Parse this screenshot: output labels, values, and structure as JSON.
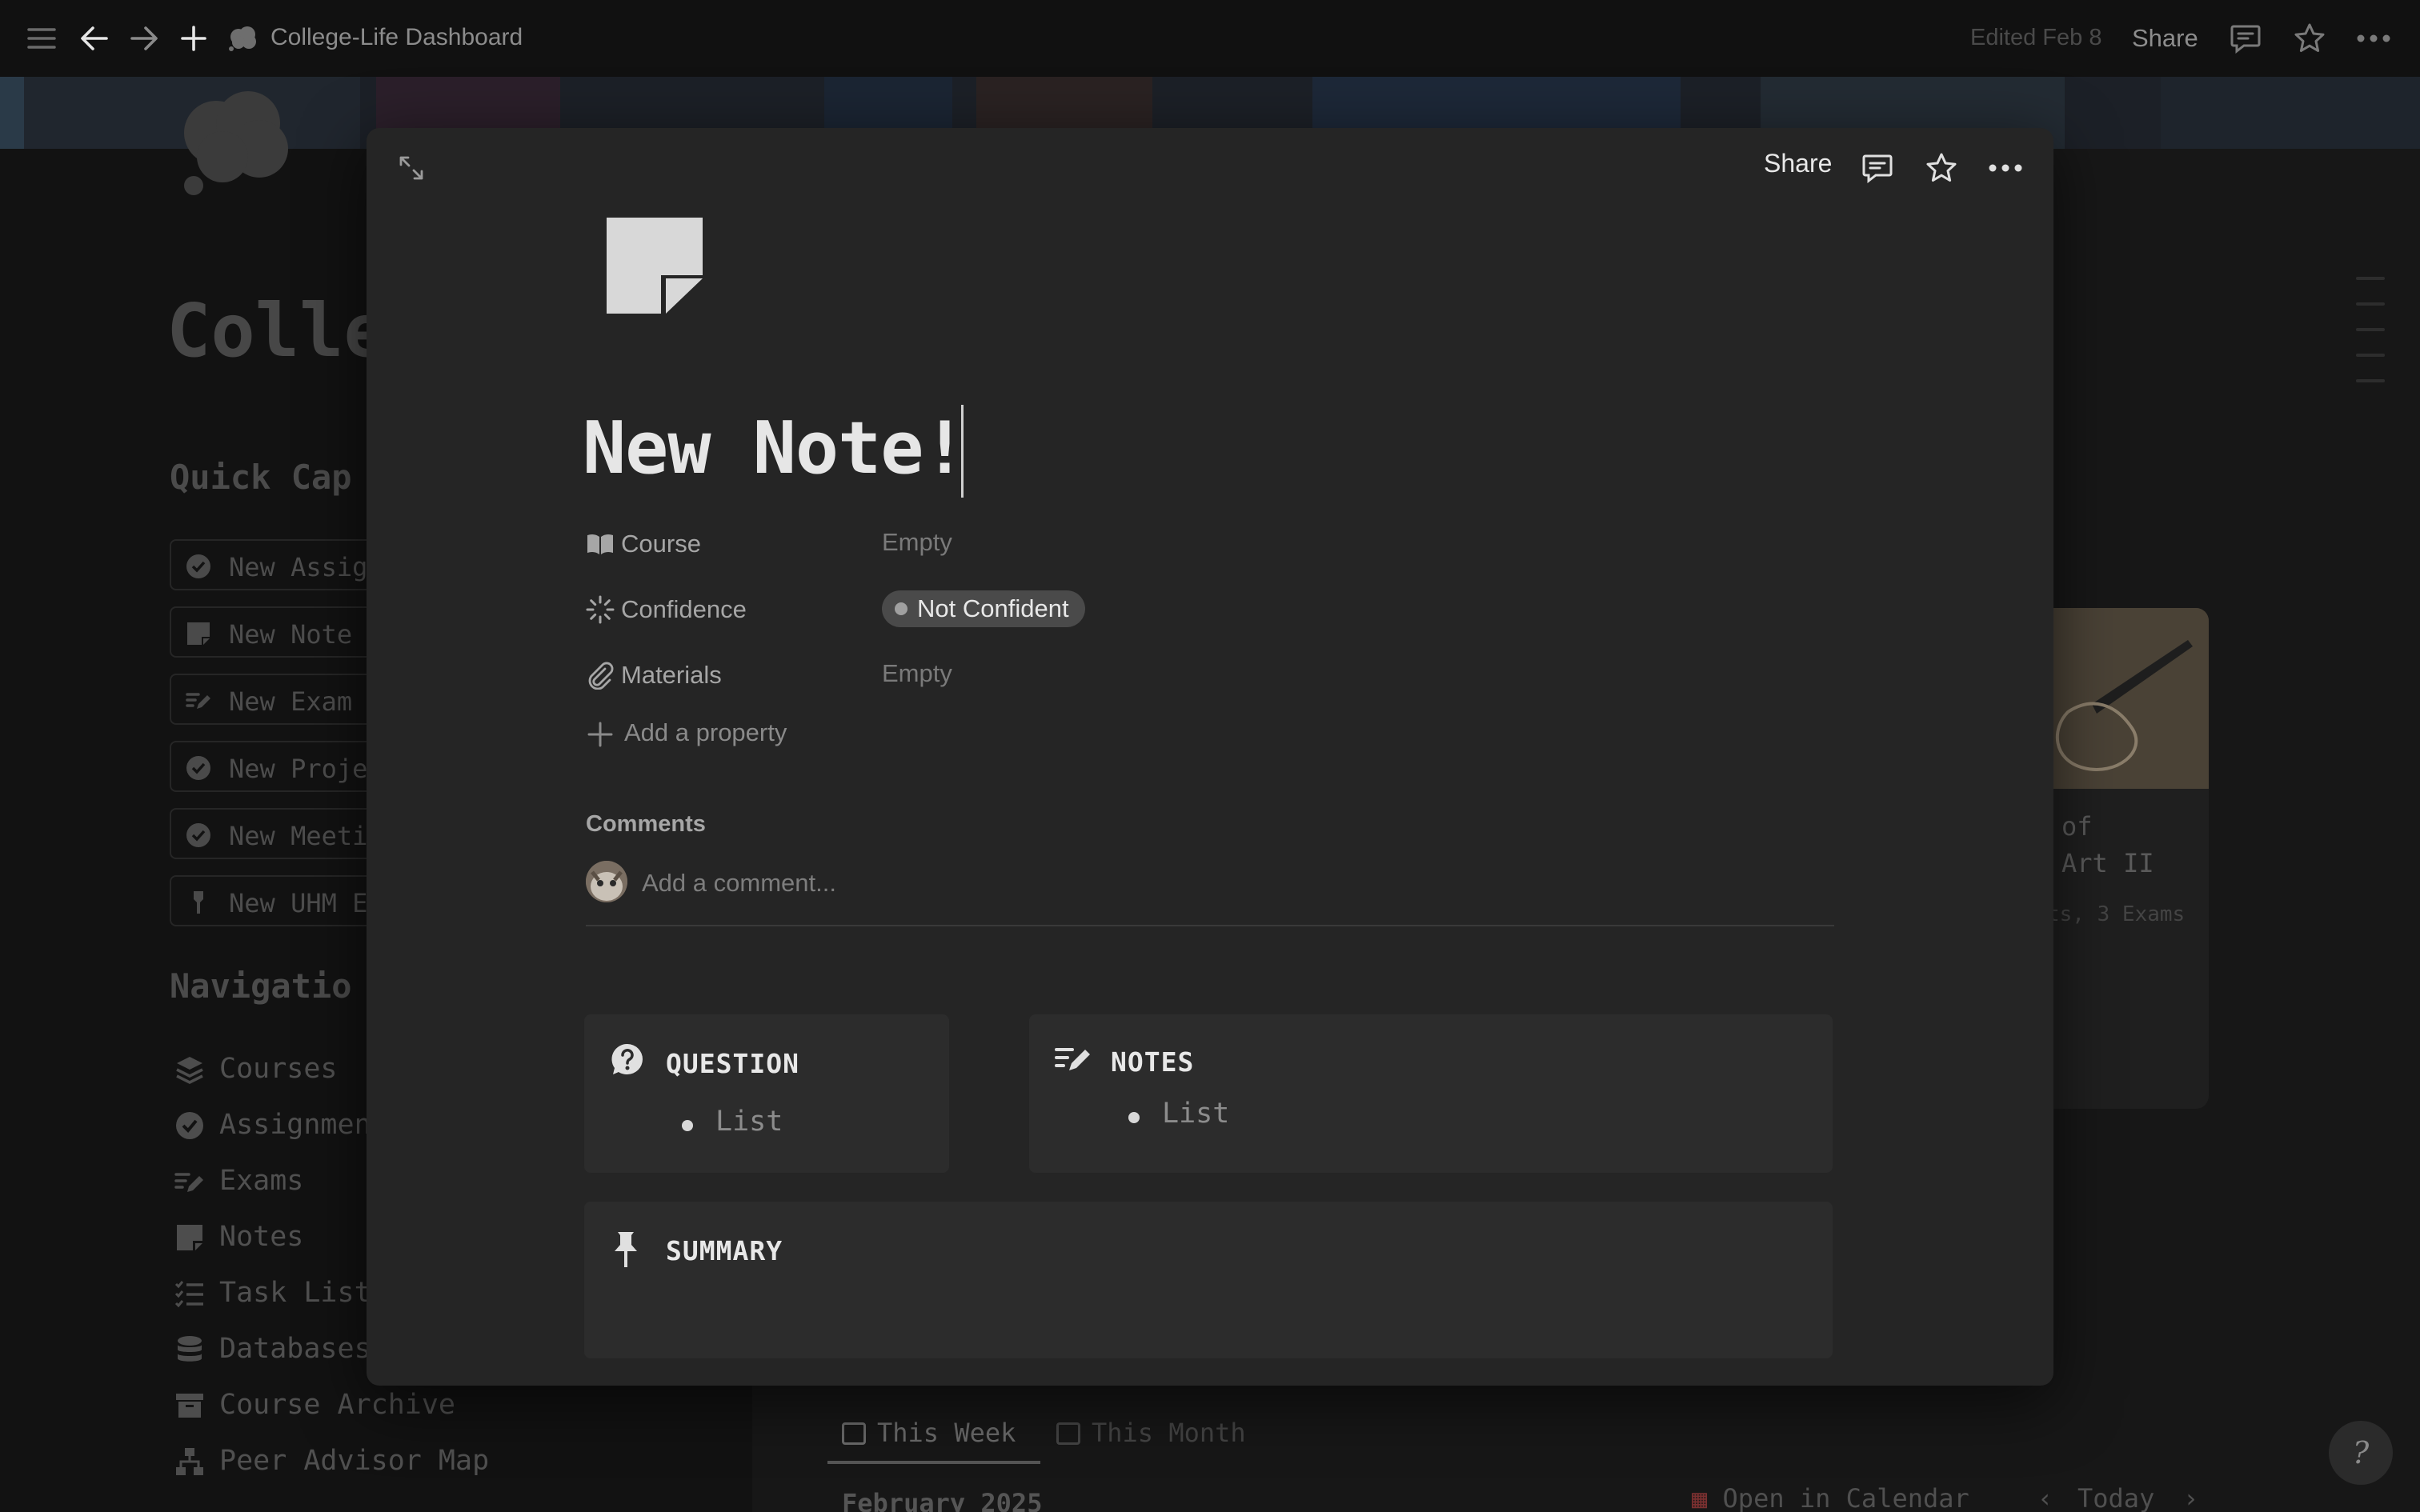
{
  "topbar": {
    "breadcrumb_title": "College-Life Dashboard",
    "edited": "Edited Feb 8",
    "share_label": "Share",
    "icons": [
      "menu-icon",
      "back-arrow-icon",
      "forward-arrow-icon",
      "plus-icon",
      "cloud-icon",
      "comment-icon",
      "star-icon",
      "more-icon"
    ]
  },
  "dashboard": {
    "title": "Colle",
    "quick_capture": {
      "heading": "Quick Cap",
      "items": [
        {
          "label": "New Assig",
          "icon": "check-circle-icon"
        },
        {
          "label": "New Note",
          "icon": "note-icon"
        },
        {
          "label": "New Exam",
          "icon": "pencil-lines-icon"
        },
        {
          "label": "New Proje",
          "icon": "check-circle-icon"
        },
        {
          "label": "New Meeti",
          "icon": "check-circle-icon"
        },
        {
          "label": "New UHM E",
          "icon": "torch-icon"
        }
      ]
    },
    "navigation": {
      "heading": "Navigatio",
      "items": [
        {
          "label": "Courses",
          "icon": "layers-icon"
        },
        {
          "label": "Assignmen",
          "icon": "check-circle-icon"
        },
        {
          "label": "Exams",
          "icon": "pencil-lines-icon"
        },
        {
          "label": "Notes",
          "icon": "note-icon"
        },
        {
          "label": "Task List",
          "icon": "checklist-icon"
        },
        {
          "label": "Databases",
          "icon": "database-icon"
        },
        {
          "label": "Course Archive",
          "icon": "archive-icon"
        },
        {
          "label": "Peer Advisor Map",
          "icon": "sitemap-icon"
        }
      ]
    },
    "course_card": {
      "title_line1": "of",
      "title_line2": "Art II",
      "subtitle": "ts, 3 Exams"
    },
    "calendar": {
      "tab_week": "This Week",
      "tab_month": "This Month",
      "month": "February 2025",
      "open_label": "Open in Calendar",
      "today_label": "Today"
    },
    "help_label": "?"
  },
  "modal": {
    "share_label": "Share",
    "title": "New Note!",
    "properties": [
      {
        "icon": "book-open-icon",
        "label": "Course",
        "value": "Empty"
      },
      {
        "icon": "loading-spinner-icon",
        "label": "Confidence",
        "value": "Not Confident"
      },
      {
        "icon": "paperclip-icon",
        "label": "Materials",
        "value": "Empty"
      }
    ],
    "add_property_label": "Add a property",
    "comments_label": "Comments",
    "comment_placeholder": "Add a comment...",
    "blocks": {
      "question": {
        "heading": "QUESTION",
        "item": "List",
        "icon": "question-bubble-icon"
      },
      "notes": {
        "heading": "NOTES",
        "item": "List",
        "icon": "pencil-lines-icon"
      },
      "summary": {
        "heading": "SUMMARY",
        "icon": "pin-icon"
      }
    }
  },
  "colors": {
    "background": "#191919",
    "modal": "#252525",
    "block": "#2c2c2c",
    "pill": "#4a4a4a",
    "text_primary": "#e6e6e6",
    "text_muted": "#7a7a7a"
  }
}
